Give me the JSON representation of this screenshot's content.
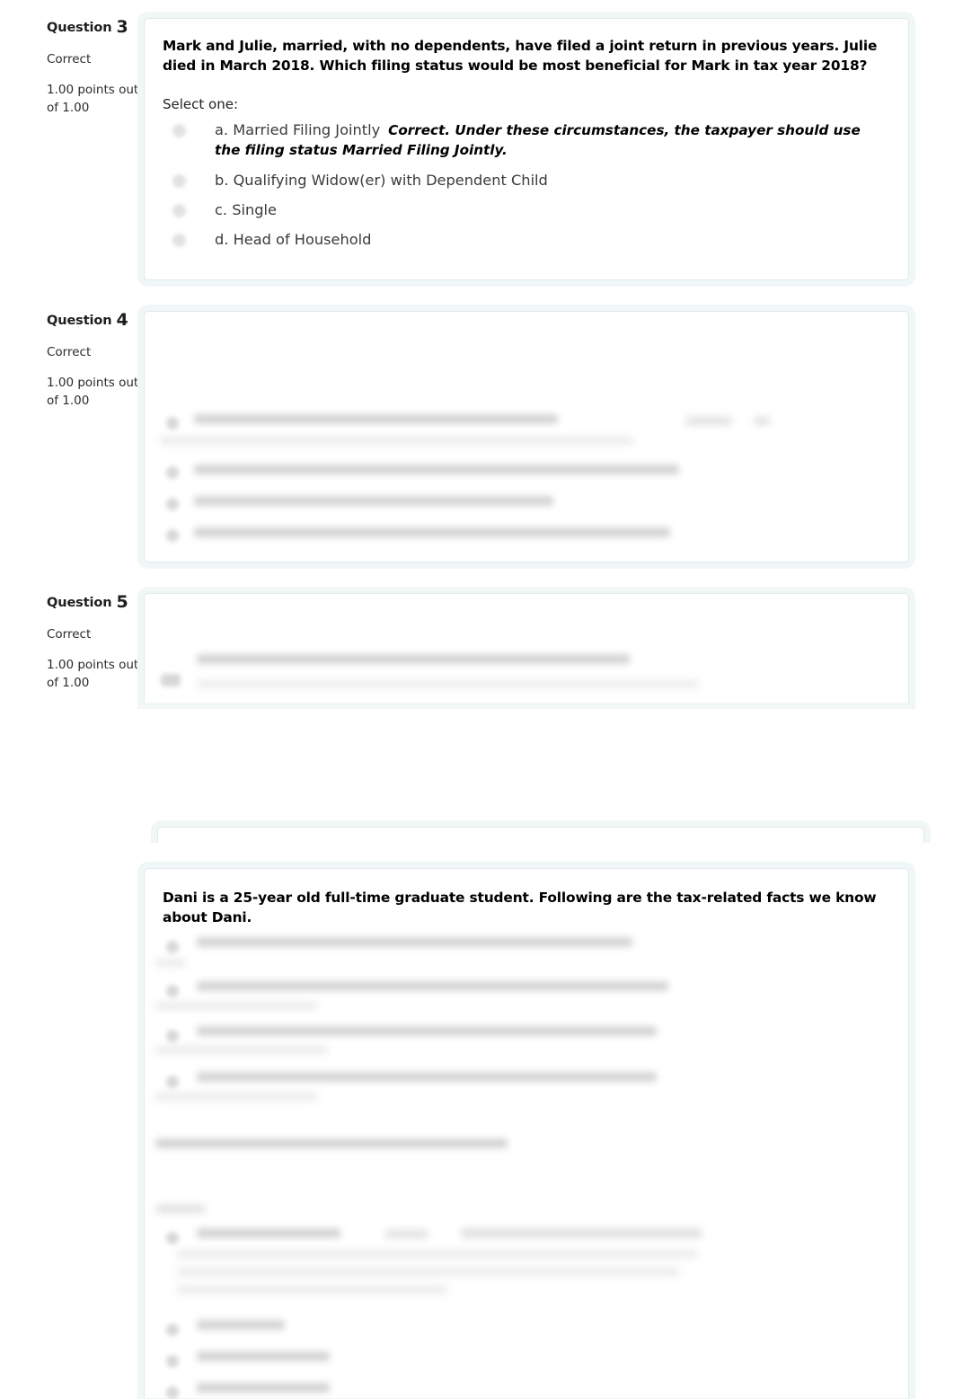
{
  "page": {
    "background": "#ffffff",
    "card_border_color": "#dfe9e9",
    "card_halo_color": "#f1f7f7"
  },
  "questions": [
    {
      "id": "q3",
      "label": "Question",
      "number": "3",
      "state": "Correct",
      "grade": "1.00 points out of 1.00",
      "stem": "Mark and Julie, married, with no dependents, have filed a joint return in previous years.  Julie died in March 2018.  Which filing status would be most beneficial for Mark in tax year 2018?",
      "select_prompt": "Select one:",
      "answers": [
        {
          "text": "a. Married Filing Jointly",
          "feedback": "Correct.  Under these circumstances, the taxpayer should use the filing status Married Filing Jointly.",
          "selected": true
        },
        {
          "text": "b. Qualifying Widow(er) with Dependent Child",
          "feedback": "",
          "selected": false
        },
        {
          "text": "c. Single",
          "feedback": "",
          "selected": false
        },
        {
          "text": "d. Head of Household",
          "feedback": "",
          "selected": false
        }
      ]
    },
    {
      "id": "q4",
      "label": "Question",
      "number": "4",
      "state": "Correct",
      "grade": "1.00 points out of 1.00",
      "stem": "",
      "select_prompt": "",
      "answers": []
    },
    {
      "id": "q5",
      "label": "Question",
      "number": "5",
      "state": "Correct",
      "grade": "1.00 points out of 1.00",
      "stem": "",
      "select_prompt": "",
      "answers": []
    },
    {
      "id": "q6",
      "label": "",
      "number": "",
      "state": "",
      "grade": "",
      "stem": "Dani is a 25-year old full-time graduate student.  Following are the tax-related facts we know about Dani.",
      "select_prompt": "",
      "answers": []
    }
  ]
}
